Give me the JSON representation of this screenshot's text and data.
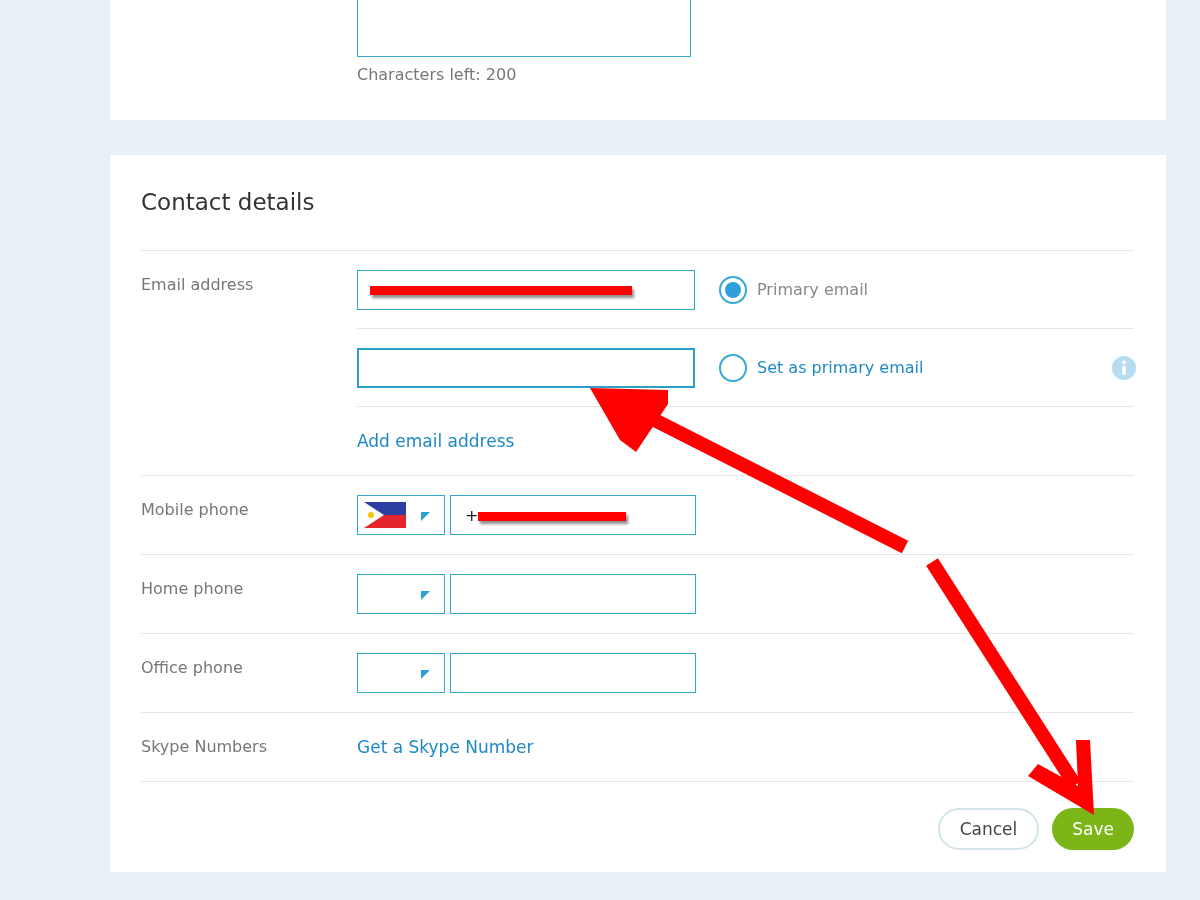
{
  "about_card": {
    "counter": "Characters left: 200"
  },
  "contact_details": {
    "title": "Contact details",
    "email": {
      "label": "Email address",
      "entries": [
        {
          "has_value": true,
          "radio_label": "Primary email",
          "selected": true
        },
        {
          "has_value": false,
          "radio_label": "Set as primary email",
          "selected": false
        }
      ],
      "add_link": "Add email address"
    },
    "phones": [
      {
        "label": "Mobile phone",
        "has_flag": true,
        "value": "+",
        "redacted": true
      },
      {
        "label": "Home phone",
        "has_flag": false,
        "redacted": false
      },
      {
        "label": "Office phone",
        "has_flag": false,
        "redacted": false
      }
    ],
    "skype_numbers": {
      "label": "Skype Numbers",
      "link": "Get a Skype Number"
    },
    "buttons": [
      {
        "kind": "secondary",
        "label": "Cancel"
      },
      {
        "kind": "primary",
        "label": "Save"
      }
    ]
  }
}
